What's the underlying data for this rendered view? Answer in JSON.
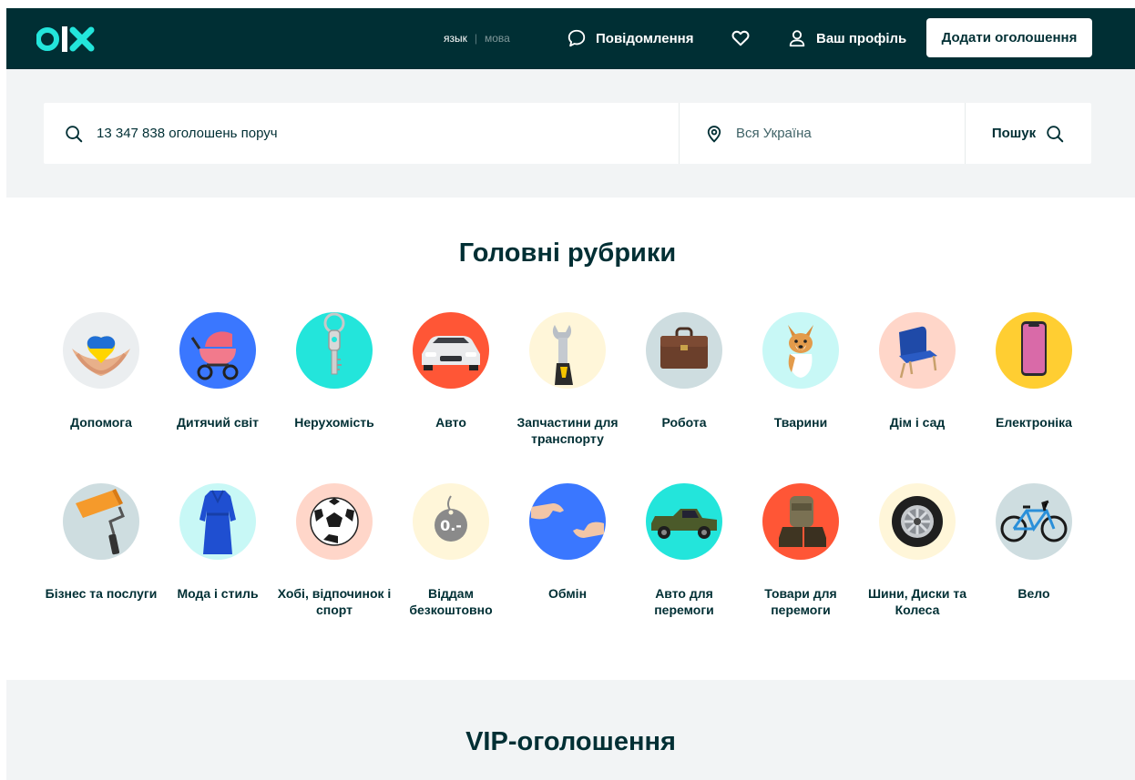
{
  "header": {
    "logo_text": "olx",
    "lang_ru": "язык",
    "lang_sep": "|",
    "lang_ua": "мова",
    "messages": "Повідомлення",
    "profile": "Ваш профіль",
    "add_ad": "Додати оголошення"
  },
  "search": {
    "placeholder": "13 347 838 оголошень поруч",
    "location": "Вся Україна",
    "button": "Пошук"
  },
  "main_categories": {
    "title": "Головні рубрики",
    "row1": [
      {
        "label": "Допомога",
        "icon": "helping-hands-icon",
        "bg": "#ebeef0"
      },
      {
        "label": "Дитячий світ",
        "icon": "baby-stroller-icon",
        "bg": "#3a77ff"
      },
      {
        "label": "Нерухомість",
        "icon": "key-icon",
        "bg": "#23e5db"
      },
      {
        "label": "Авто",
        "icon": "car-icon",
        "bg": "#ff5636"
      },
      {
        "label": "Запчастини для транспорту",
        "icon": "wrench-icon",
        "bg": "#fff6d9"
      },
      {
        "label": "Робота",
        "icon": "briefcase-icon",
        "bg": "#cedde0"
      },
      {
        "label": "Тварини",
        "icon": "dog-icon",
        "bg": "#c8f8f6"
      },
      {
        "label": "Дім і сад",
        "icon": "armchair-icon",
        "bg": "#ffd6c9"
      },
      {
        "label": "Електроніка",
        "icon": "smartphone-icon",
        "bg": "#ffce32"
      }
    ],
    "row2": [
      {
        "label": "Бізнес та послуги",
        "icon": "paint-roller-icon",
        "bg": "#cedde0"
      },
      {
        "label": "Мода і стиль",
        "icon": "dress-icon",
        "bg": "#c8f8f6"
      },
      {
        "label": "Хобі, відпочинок і спорт",
        "icon": "soccer-ball-icon",
        "bg": "#ffd6c9"
      },
      {
        "label": "Віддам безкоштовно",
        "icon": "free-tag-icon",
        "bg": "#fff6d9"
      },
      {
        "label": "Обмін",
        "icon": "exchange-hands-icon",
        "bg": "#3a77ff"
      },
      {
        "label": "Авто для перемоги",
        "icon": "pickup-truck-icon",
        "bg": "#23e5db"
      },
      {
        "label": "Товари для перемоги",
        "icon": "military-gear-icon",
        "bg": "#ff5636"
      },
      {
        "label": "Шини, Диски та Колеса",
        "icon": "wheel-icon",
        "bg": "#fff6d9"
      },
      {
        "label": "Вело",
        "icon": "bicycle-icon",
        "bg": "#cedde0"
      }
    ]
  },
  "vip": {
    "title": "VIP-оголошення"
  },
  "colors": {
    "header_bg": "#002f34",
    "accent": "#23e5db",
    "text": "#002f34",
    "section_bg": "#f2f4f5"
  }
}
